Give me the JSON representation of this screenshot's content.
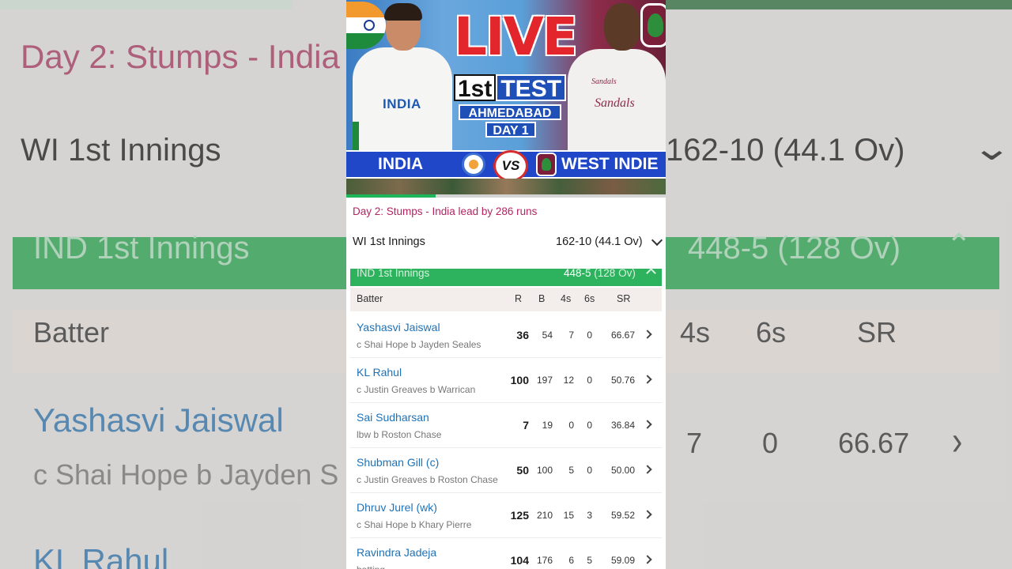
{
  "thumbnail": {
    "live_label": "LIVE",
    "match_number": "1st",
    "match_format": "TEST",
    "venue": "AHMEDABAD",
    "day": "DAY 1",
    "team1": "INDIA",
    "team2": "WEST INDIE",
    "vs_label": "VS",
    "jersey_india": "INDIA",
    "jersey_wi": "Sandals",
    "jersey_wi_small": "Sandals",
    "progress_fraction": 0.28,
    "colors": {
      "team_band": "#2147c9",
      "live": "#e3262b",
      "progress": "#1db45a"
    }
  },
  "match_status": "Day 2: Stumps - India lead by 286 runs",
  "innings1": {
    "label": "WI 1st Innings",
    "score": "162-10",
    "overs": "(44.1 Ov)"
  },
  "innings2": {
    "label": "IND 1st Innings",
    "score": "448-5",
    "overs": "(128 Ov)"
  },
  "table_headers": {
    "batter": "Batter",
    "runs": "R",
    "balls": "B",
    "fours": "4s",
    "sixes": "6s",
    "strike_rate": "SR"
  },
  "batters": [
    {
      "name": "Yashasvi Jaiswal",
      "dismissal": "c Shai Hope b Jayden Seales",
      "runs": "36",
      "balls": "54",
      "fours": "7",
      "sixes": "0",
      "sr": "66.67"
    },
    {
      "name": "KL Rahul",
      "dismissal": "c Justin Greaves b Warrican",
      "runs": "100",
      "balls": "197",
      "fours": "12",
      "sixes": "0",
      "sr": "50.76"
    },
    {
      "name": "Sai Sudharsan",
      "dismissal": "lbw b Roston Chase",
      "runs": "7",
      "balls": "19",
      "fours": "0",
      "sixes": "0",
      "sr": "36.84"
    },
    {
      "name": "Shubman Gill (c)",
      "dismissal": "c Justin Greaves b Roston Chase",
      "runs": "50",
      "balls": "100",
      "fours": "5",
      "sixes": "0",
      "sr": "50.00"
    },
    {
      "name": "Dhruv Jurel (wk)",
      "dismissal": "c Shai Hope b Khary Pierre",
      "runs": "125",
      "balls": "210",
      "fours": "15",
      "sixes": "3",
      "sr": "59.52"
    },
    {
      "name": "Ravindra Jadeja",
      "dismissal": "batting",
      "runs": "104",
      "balls": "176",
      "fours": "6",
      "sixes": "5",
      "sr": "59.09"
    }
  ],
  "background": {
    "status": "Day 2: Stumps - India",
    "innings1_label": "WI 1st Innings",
    "innings1_score": "162-10 (44.1 Ov)",
    "innings2_label": "IND 1st Innings",
    "innings2_score": "448-5 (128 Ov)",
    "batter": "Batter",
    "fours": "4s",
    "sixes": "6s",
    "sr": "SR",
    "name1": "Yashasvi Jaiswal",
    "dismissal1": "c Shai Hope b Jayden S",
    "v_fours": "7",
    "v_sixes": "0",
    "v_sr": "66.67",
    "name2": "KL Rahul"
  }
}
